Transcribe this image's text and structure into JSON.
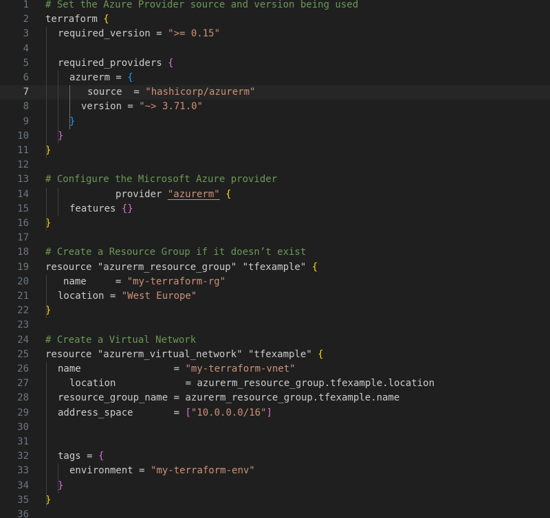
{
  "editor": {
    "lines": [
      {
        "number": "1",
        "tokens": [
          {
            "text": "# Set the Azure Provider source and version being used",
            "kind": "comment"
          }
        ]
      },
      {
        "number": "2",
        "tokens": [
          {
            "text": "terraform ",
            "kind": "plain"
          },
          {
            "text": "{",
            "kind": "br1"
          }
        ]
      },
      {
        "number": "3",
        "tokens": [
          {
            "text": "required_version = ",
            "kind": "plain"
          },
          {
            "text": "\">= 0.15\"",
            "kind": "string"
          }
        ]
      },
      {
        "number": "4",
        "tokens": []
      },
      {
        "number": "5",
        "tokens": [
          {
            "text": "required_providers ",
            "kind": "plain"
          },
          {
            "text": "{",
            "kind": "br2"
          }
        ]
      },
      {
        "number": "6",
        "tokens": [
          {
            "text": "azurerm = ",
            "kind": "plain"
          },
          {
            "text": "{",
            "kind": "br3"
          }
        ]
      },
      {
        "number": "7",
        "tokens": [
          {
            "text": "source  = ",
            "kind": "plain"
          },
          {
            "text": "\"hashicorp/azurerm\"",
            "kind": "string"
          }
        ]
      },
      {
        "number": "8",
        "tokens": [
          {
            "text": "version = ",
            "kind": "plain"
          },
          {
            "text": "\"~> 3.71.0\"",
            "kind": "string"
          }
        ]
      },
      {
        "number": "9",
        "tokens": [
          {
            "text": "}",
            "kind": "br3"
          }
        ]
      },
      {
        "number": "10",
        "tokens": [
          {
            "text": "}",
            "kind": "br2"
          }
        ]
      },
      {
        "number": "11",
        "tokens": [
          {
            "text": "}",
            "kind": "br1"
          }
        ]
      },
      {
        "number": "12",
        "tokens": []
      },
      {
        "number": "13",
        "tokens": [
          {
            "text": "# Configure the Microsoft Azure provider",
            "kind": "comment"
          }
        ]
      },
      {
        "number": "14",
        "tokens": [
          {
            "text": "provider ",
            "kind": "plain"
          },
          {
            "text": "\"azurerm\"",
            "kind": "string-ul"
          },
          {
            "text": " ",
            "kind": "plain"
          },
          {
            "text": "{",
            "kind": "br1"
          }
        ]
      },
      {
        "number": "15",
        "tokens": [
          {
            "text": "features ",
            "kind": "plain"
          },
          {
            "text": "{}",
            "kind": "br2"
          }
        ]
      },
      {
        "number": "16",
        "tokens": [
          {
            "text": "}",
            "kind": "br1"
          }
        ]
      },
      {
        "number": "17",
        "tokens": []
      },
      {
        "number": "18",
        "tokens": [
          {
            "text": "# Create a Resource Group if it doesn’t exist",
            "kind": "comment"
          }
        ]
      },
      {
        "number": "19",
        "tokens": [
          {
            "text": "resource \"azurerm_resource_group\" \"tfexample\" ",
            "kind": "plain"
          },
          {
            "text": "{",
            "kind": "br1"
          }
        ]
      },
      {
        "number": "20",
        "tokens": [
          {
            "text": "name     = ",
            "kind": "plain"
          },
          {
            "text": "\"my-terraform-rg\"",
            "kind": "string"
          }
        ]
      },
      {
        "number": "21",
        "tokens": [
          {
            "text": "location = ",
            "kind": "plain"
          },
          {
            "text": "\"West Europe\"",
            "kind": "string"
          }
        ]
      },
      {
        "number": "22",
        "tokens": [
          {
            "text": "}",
            "kind": "br1"
          }
        ]
      },
      {
        "number": "23",
        "tokens": []
      },
      {
        "number": "24",
        "tokens": [
          {
            "text": "# Create a Virtual Network",
            "kind": "comment"
          }
        ]
      },
      {
        "number": "25",
        "tokens": [
          {
            "text": "resource \"azurerm_virtual_network\" \"tfexample\" ",
            "kind": "plain"
          },
          {
            "text": "{",
            "kind": "br1"
          }
        ]
      },
      {
        "number": "26",
        "tokens": [
          {
            "text": "name                = ",
            "kind": "plain"
          },
          {
            "text": "\"my-terraform-vnet\"",
            "kind": "string"
          }
        ]
      },
      {
        "number": "27",
        "tokens": [
          {
            "text": "location            = azurerm_resource_group.tfexample.location",
            "kind": "plain"
          }
        ]
      },
      {
        "number": "28",
        "tokens": [
          {
            "text": "resource_group_name = azurerm_resource_group.tfexample.name",
            "kind": "plain"
          }
        ]
      },
      {
        "number": "29",
        "tokens": [
          {
            "text": "address_space       = ",
            "kind": "plain"
          },
          {
            "text": "[",
            "kind": "br2"
          },
          {
            "text": "\"10.0.0.0/16\"",
            "kind": "string"
          },
          {
            "text": "]",
            "kind": "br2"
          }
        ]
      },
      {
        "number": "30",
        "tokens": []
      },
      {
        "number": "31",
        "tokens": []
      },
      {
        "number": "32",
        "tokens": [
          {
            "text": "tags = ",
            "kind": "plain"
          },
          {
            "text": "{",
            "kind": "br2"
          }
        ]
      },
      {
        "number": "33",
        "tokens": [
          {
            "text": "environment = ",
            "kind": "plain"
          },
          {
            "text": "\"my-terraform-env\"",
            "kind": "string"
          }
        ]
      },
      {
        "number": "34",
        "tokens": [
          {
            "text": "}",
            "kind": "br2"
          }
        ]
      },
      {
        "number": "35",
        "tokens": [
          {
            "text": "}",
            "kind": "br1"
          }
        ]
      },
      {
        "number": "36",
        "tokens": []
      }
    ]
  }
}
